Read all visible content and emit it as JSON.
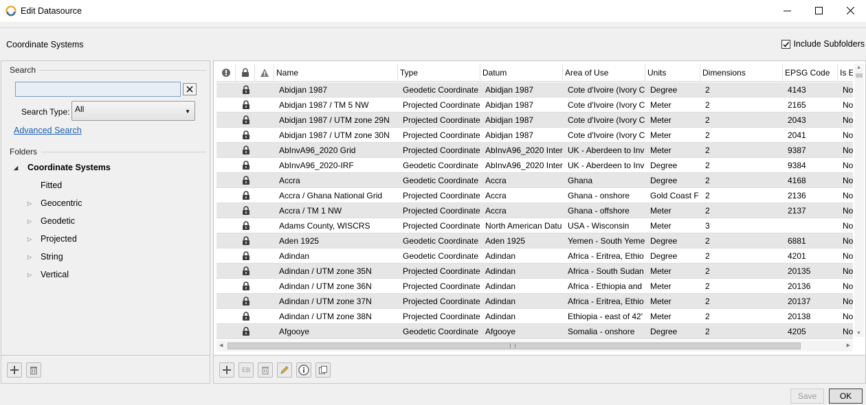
{
  "window": {
    "title": "Edit Datasource"
  },
  "topbar": {
    "section_label": "Coordinate Systems",
    "include_subfolders": "Include Subfolders"
  },
  "search": {
    "group_label": "Search",
    "input_value": "",
    "type_label": "Search Type:",
    "type_value": "All",
    "advanced_link": "Advanced Search"
  },
  "folders": {
    "group_label": "Folders",
    "root": "Coordinate Systems",
    "children": [
      "Fitted",
      "Geocentric",
      "Geodetic",
      "Projected",
      "String",
      "Vertical"
    ]
  },
  "grid": {
    "headers": [
      "Name",
      "Type",
      "Datum",
      "Area of Use",
      "Units",
      "Dimensions",
      "EPSG Code",
      "Is E"
    ],
    "rows": [
      [
        "Abidjan 1987",
        "Geodetic Coordinate",
        "Abidjan 1987",
        "Cote d'Ivoire (Ivory C",
        "Degree",
        "2",
        "4143",
        "No"
      ],
      [
        "Abidjan 1987 / TM 5 NW",
        "Projected Coordinate",
        "Abidjan 1987",
        "Cote d'Ivoire (Ivory C",
        "Meter",
        "2",
        "2165",
        "No"
      ],
      [
        "Abidjan 1987 / UTM zone 29N",
        "Projected Coordinate",
        "Abidjan 1987",
        "Cote d'Ivoire (Ivory C",
        "Meter",
        "2",
        "2043",
        "No"
      ],
      [
        "Abidjan 1987 / UTM zone 30N",
        "Projected Coordinate",
        "Abidjan 1987",
        "Cote d'Ivoire (Ivory C",
        "Meter",
        "2",
        "2041",
        "No"
      ],
      [
        "AbInvA96_2020 Grid",
        "Projected Coordinate",
        "AbInvA96_2020 Inter",
        "UK - Aberdeen to Inv",
        "Meter",
        "2",
        "9387",
        "No"
      ],
      [
        "AbInvA96_2020-IRF",
        "Geodetic Coordinate",
        "AbInvA96_2020 Inter",
        "UK - Aberdeen to Inv",
        "Degree",
        "2",
        "9384",
        "No"
      ],
      [
        "Accra",
        "Geodetic Coordinate",
        "Accra",
        "Ghana",
        "Degree",
        "2",
        "4168",
        "No"
      ],
      [
        "Accra / Ghana National Grid",
        "Projected Coordinate",
        "Accra",
        "Ghana - onshore",
        "Gold Coast F",
        "2",
        "2136",
        "No"
      ],
      [
        "Accra / TM 1 NW",
        "Projected Coordinate",
        "Accra",
        "Ghana - offshore",
        "Meter",
        "2",
        "2137",
        "No"
      ],
      [
        "Adams County, WISCRS",
        "Projected Coordinate",
        "North American Datu",
        "USA - Wisconsin",
        "Meter",
        "3",
        "",
        "No"
      ],
      [
        "Aden 1925",
        "Geodetic Coordinate",
        "Aden 1925",
        "Yemen - South Yeme",
        "Degree",
        "2",
        "6881",
        "No"
      ],
      [
        "Adindan",
        "Geodetic Coordinate",
        "Adindan",
        "Africa - Eritrea, Ethio",
        "Degree",
        "2",
        "4201",
        "No"
      ],
      [
        "Adindan / UTM zone 35N",
        "Projected Coordinate",
        "Adindan",
        "Africa - South Sudan",
        "Meter",
        "2",
        "20135",
        "No"
      ],
      [
        "Adindan / UTM zone 36N",
        "Projected Coordinate",
        "Adindan",
        "Africa - Ethiopia and",
        "Meter",
        "2",
        "20136",
        "No"
      ],
      [
        "Adindan / UTM zone 37N",
        "Projected Coordinate",
        "Adindan",
        "Africa - Eritrea, Ethio",
        "Meter",
        "2",
        "20137",
        "No"
      ],
      [
        "Adindan / UTM zone 38N",
        "Projected Coordinate",
        "Adindan",
        "Ethiopia - east of 42'",
        "Meter",
        "2",
        "20138",
        "No"
      ],
      [
        "Afgooye",
        "Geodetic Coordinate",
        "Afgooye",
        "Somalia - onshore",
        "Degree",
        "2",
        "4205",
        "No"
      ]
    ]
  },
  "footer": {
    "left_icons": [
      "add-icon",
      "trash-icon"
    ],
    "right_icons": [
      "add-icon",
      "eb-icon",
      "trash-icon",
      "pencil-icon",
      "info-icon",
      "copy-icon"
    ],
    "eb_label": "EB",
    "save_label": "Save",
    "ok_label": "OK"
  }
}
